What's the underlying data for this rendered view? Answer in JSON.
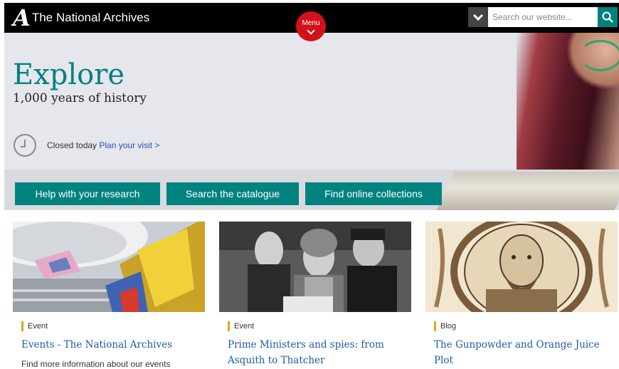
{
  "header": {
    "logo_text": "The National Archives",
    "logo_mark": "A",
    "menu_label": "Menu",
    "search_placeholder": "Search our website..."
  },
  "hero": {
    "title": "Explore",
    "subtitle": "1,000 years of history",
    "status": "Closed today",
    "plan_link": "Plan your visit >",
    "buttons": [
      {
        "label": "Help with your research"
      },
      {
        "label": "Search the catalogue"
      },
      {
        "label": "Find online collections"
      }
    ]
  },
  "cards": [
    {
      "tag": "Event",
      "title": "Events - The National Archives",
      "description": "Find more information about our events"
    },
    {
      "tag": "Event",
      "title": "Prime Ministers and spies: from Asquith to Thatcher",
      "description": ""
    },
    {
      "tag": "Blog",
      "title": "The Gunpowder and Orange Juice Plot",
      "description": ""
    }
  ],
  "colors": {
    "accent": "#00827f",
    "menu": "#d4111b",
    "tag_bar": "#e7a31b",
    "link": "#1f5aa8"
  }
}
